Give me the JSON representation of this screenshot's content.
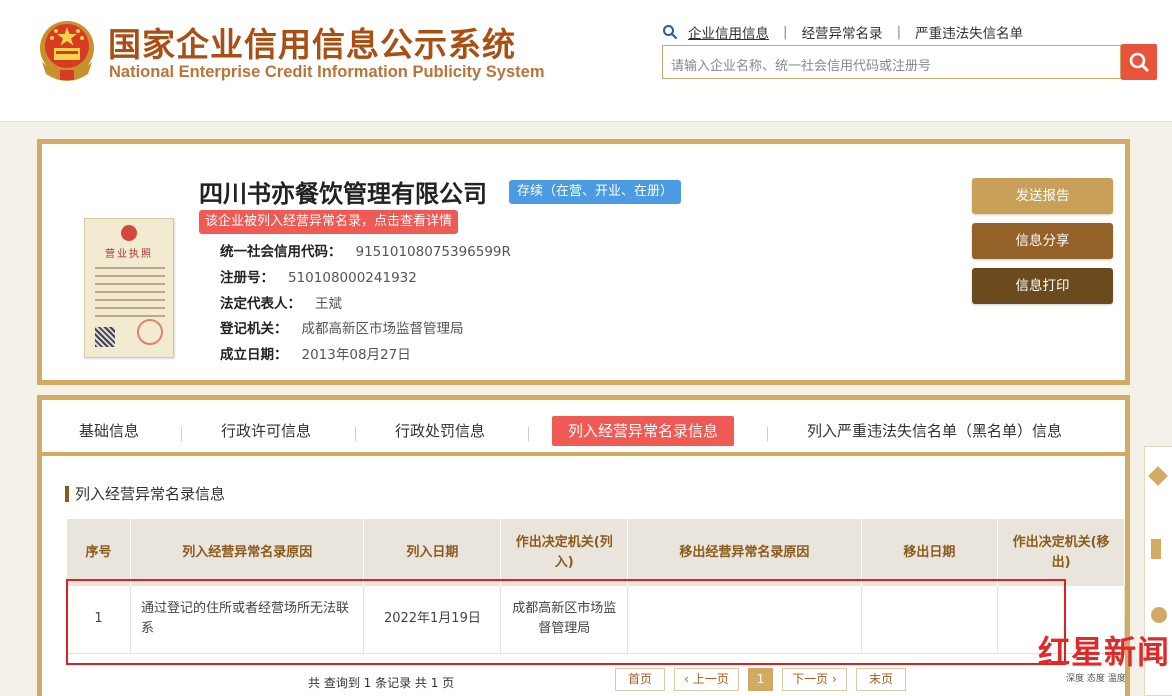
{
  "site": {
    "title_cn": "国家企业信用信息公示系统",
    "title_en": "National Enterprise Credit Information Publicity System"
  },
  "top_nav": [
    {
      "label": "企业信用信息",
      "active": true
    },
    {
      "label": "经营异常名录",
      "active": false
    },
    {
      "label": "严重违法失信名单",
      "active": false
    }
  ],
  "search": {
    "placeholder": "请输入企业名称、统一社会信用代码或注册号"
  },
  "company": {
    "name": "四川书亦餐饮管理有限公司",
    "status": "存续（在营、开业、在册）",
    "alert": "该企业被列入经营异常名录，点击查看详情",
    "license_title": "营业执照",
    "fields": [
      {
        "label": "统一社会信用代码：",
        "value": "91510108075396599R"
      },
      {
        "label": "注册号：",
        "value": "510108000241932"
      },
      {
        "label": "法定代表人：",
        "value": "王斌"
      },
      {
        "label": "登记机关：",
        "value": "成都高新区市场监督管理局"
      },
      {
        "label": "成立日期：",
        "value": "2013年08月27日"
      }
    ]
  },
  "actions": {
    "send_report": "发送报告",
    "share": "信息分享",
    "print": "信息打印"
  },
  "tabs": [
    {
      "label": "基础信息",
      "active": false
    },
    {
      "label": "行政许可信息",
      "active": false
    },
    {
      "label": "行政处罚信息",
      "active": false
    },
    {
      "label": "列入经营异常名录信息",
      "active": true
    },
    {
      "label": "列入严重违法失信名单（黑名单）信息",
      "active": false
    }
  ],
  "section_title": "列入经营异常名录信息",
  "table": {
    "headers": [
      "序号",
      "列入经营异常名录原因",
      "列入日期",
      "作出决定机关(列入)",
      "移出经营异常名录原因",
      "移出日期",
      "作出决定机关(移出)"
    ],
    "rows": [
      [
        "1",
        "通过登记的住所或者经营场所无法联系",
        "2022年1月19日",
        "成都高新区市场监督管理局",
        "",
        "",
        ""
      ]
    ]
  },
  "pagination": {
    "summary": "共 查询到 1 条记录 共 1 页",
    "first": "首页",
    "prev": "上一页",
    "current": "1",
    "next": "下一页",
    "last": "末页"
  },
  "watermark": {
    "main": "红星新闻",
    "sub": "深度 态度 温度"
  },
  "colors": {
    "gold": "#d2aa62",
    "brand_brown": "#a94f13",
    "alert_red": "#ef5a55",
    "status_blue": "#4a9be2",
    "btn_send": "#c9a05a",
    "btn_share": "#946129",
    "btn_print": "#6b4a1e"
  },
  "icons": [
    "national-emblem-icon",
    "magnifier-icon",
    "search-icon"
  ]
}
